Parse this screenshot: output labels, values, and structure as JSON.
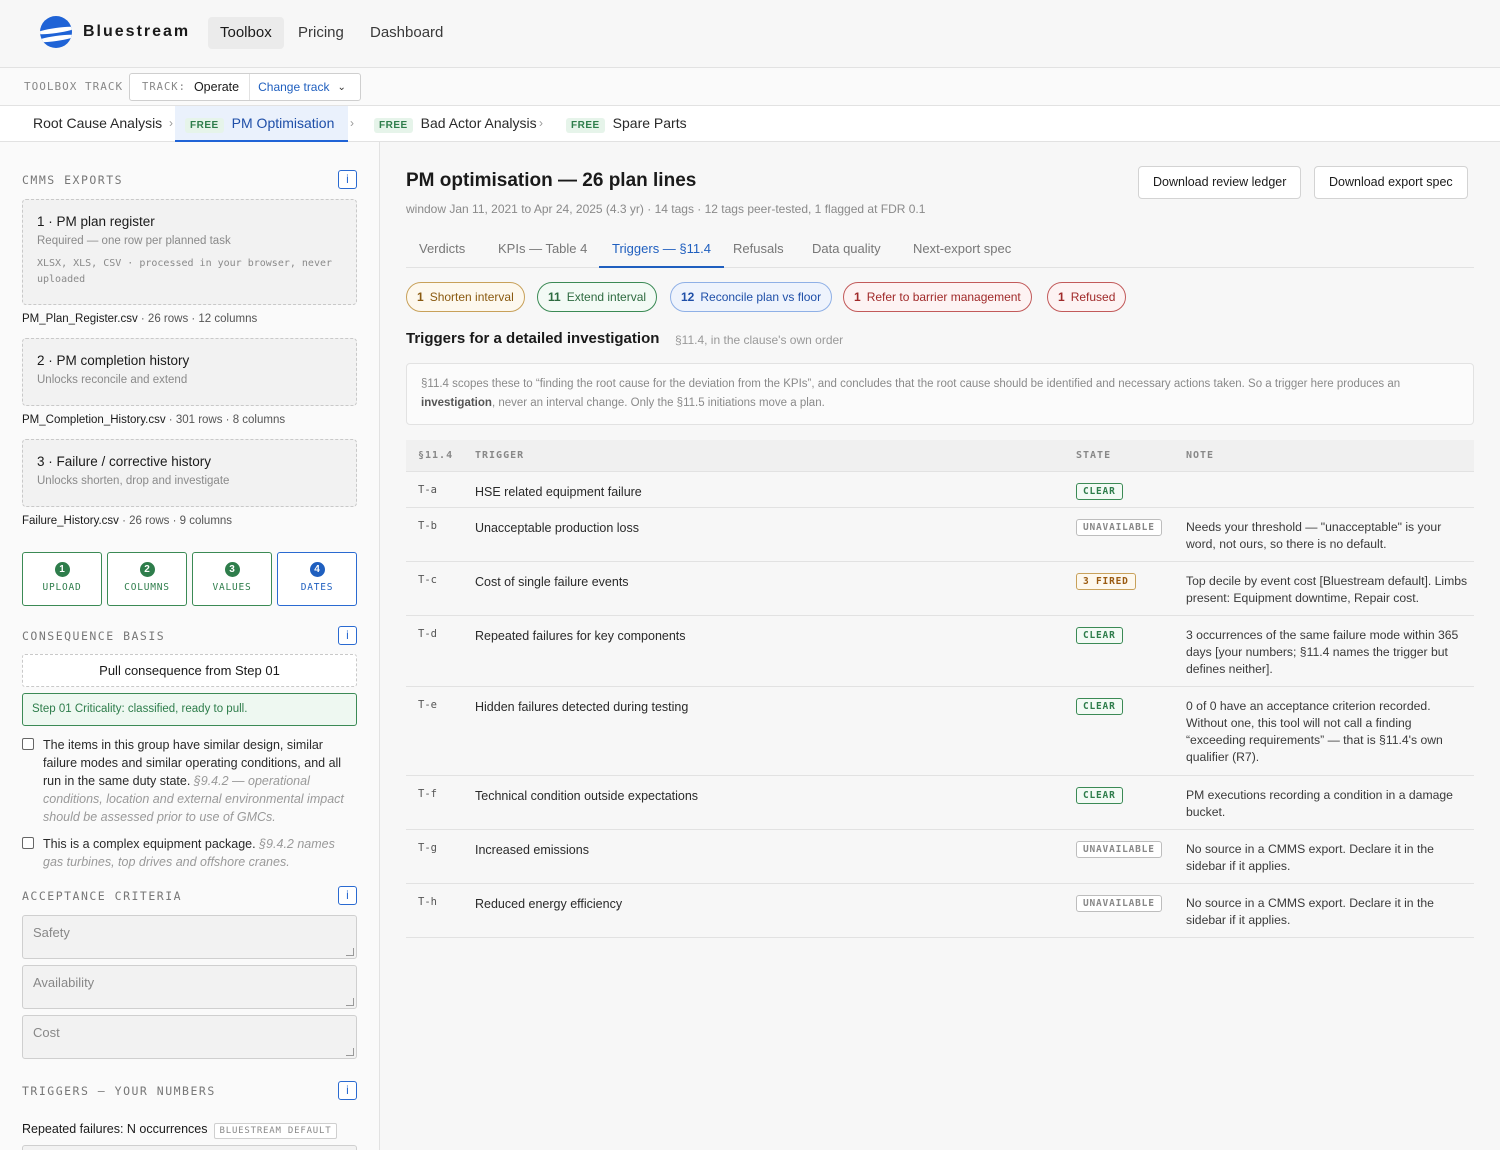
{
  "brand": {
    "name": "Bluestream"
  },
  "nav": {
    "items": [
      "Toolbox",
      "Pricing",
      "Dashboard"
    ],
    "active": "Toolbox"
  },
  "track": {
    "label": "TOOLBOX TRACK",
    "key": "TRACK:",
    "value": "Operate",
    "change": "Change track"
  },
  "tools": [
    {
      "label": "Root Cause Analysis",
      "free": ""
    },
    {
      "label": "PM Optimisation",
      "free": "FREE"
    },
    {
      "label": "Bad Actor Analysis",
      "free": "FREE"
    },
    {
      "label": "Spare Parts",
      "free": "FREE"
    }
  ],
  "sidebar": {
    "cmms_title": "CMMS EXPORTS",
    "info": "i",
    "drop1": {
      "title": "1 · PM plan register",
      "sub": "Required — one row per planned task",
      "mono": "XLSX, XLS, CSV · processed in your browser, never uploaded"
    },
    "file1": {
      "name": "PM_Plan_Register.csv",
      "meta": " · 26 rows · 12 columns"
    },
    "drop2": {
      "title": "2 · PM completion history",
      "sub": "Unlocks reconcile and extend"
    },
    "file2": {
      "name": "PM_Completion_History.csv",
      "meta": " · 301 rows · 8 columns"
    },
    "drop3": {
      "title": "3 · Failure / corrective history",
      "sub": "Unlocks shorten, drop and investigate"
    },
    "file3": {
      "name": "Failure_History.csv",
      "meta": " · 26 rows · 9 columns"
    },
    "steps": [
      {
        "n": "1",
        "label": "UPLOAD"
      },
      {
        "n": "2",
        "label": "COLUMNS"
      },
      {
        "n": "3",
        "label": "VALUES"
      },
      {
        "n": "4",
        "label": "DATES"
      }
    ],
    "consequence_title": "CONSEQUENCE BASIS",
    "pull_button": "Pull consequence from Step 01",
    "ok_status": "Step 01 Criticality: classified, ready to pull.",
    "check1": {
      "text": "The items in this group have similar design, similar failure modes and similar operating conditions, and all run in the same duty state.",
      "hint": "§9.4.2 — operational conditions, location and external environmental impact should be assessed prior to use of GMCs."
    },
    "check2": {
      "text": "This is a complex equipment package.",
      "hint": "§9.4.2 names gas turbines, top drives and offshore cranes."
    },
    "acceptance_title": "ACCEPTANCE CRITERIA",
    "acceptance_placeholders": [
      "Safety",
      "Availability",
      "Cost"
    ],
    "triggers_title": "TRIGGERS — YOUR NUMBERS",
    "repeated_label": "Repeated failures: N occurrences",
    "repeated_badge": "BLUESTREAM DEFAULT"
  },
  "main": {
    "title": "PM optimisation — 26 plan lines",
    "subtitle": "window Jan 11, 2021 to Apr 24, 2025 (4.3 yr) · 14 tags · 12 tags peer-tested, 1 flagged at FDR 0.1",
    "buttons": {
      "ledger": "Download review ledger",
      "spec": "Download export spec"
    },
    "tabs": [
      "Verdicts",
      "KPIs — Table 4",
      "Triggers — §11.4",
      "Refusals",
      "Data quality",
      "Next-export spec"
    ],
    "active_tab": "Triggers — §11.4",
    "pills": [
      {
        "count": "1",
        "label": "Shorten interval",
        "kind": "amber"
      },
      {
        "count": "11",
        "label": "Extend interval",
        "kind": "green"
      },
      {
        "count": "12",
        "label": "Reconcile plan vs floor",
        "kind": "blue"
      },
      {
        "count": "1",
        "label": "Refer to barrier management",
        "kind": "red"
      },
      {
        "count": "1",
        "label": "Refused",
        "kind": "red"
      }
    ],
    "section_title": "Triggers for a detailed investigation",
    "section_sub": "§11.4, in the clause's own order",
    "note": {
      "pre": "§11.4 scopes these to “finding the root cause for the deviation from the KPIs”, and concludes that the root cause should be identified and necessary actions taken. So a trigger here produces an ",
      "bold": "investigation",
      "post": ", never an interval change. Only the §11.5 initiations move a plan."
    },
    "table": {
      "headers": [
        "§11.4",
        "TRIGGER",
        "STATE",
        "NOTE"
      ],
      "rows": [
        {
          "code": "T-a",
          "trigger": "HSE related equipment failure",
          "state": "CLEAR",
          "kind": "clear",
          "note": ""
        },
        {
          "code": "T-b",
          "trigger": "Unacceptable production loss",
          "state": "UNAVAILABLE",
          "kind": "unav",
          "note": "Needs your threshold — \"unacceptable\" is your word, not ours, so there is no default."
        },
        {
          "code": "T-c",
          "trigger": "Cost of single failure events",
          "state": "3 FIRED",
          "kind": "fired",
          "note": "Top decile by event cost [Bluestream default]. Limbs present: Equipment downtime, Repair cost."
        },
        {
          "code": "T-d",
          "trigger": "Repeated failures for key components",
          "state": "CLEAR",
          "kind": "clear",
          "note": "3 occurrences of the same failure mode within 365 days [your numbers; §11.4 names the trigger but defines neither]."
        },
        {
          "code": "T-e",
          "trigger": "Hidden failures detected during testing",
          "state": "CLEAR",
          "kind": "clear",
          "note": "0 of 0 have an acceptance criterion recorded. Without one, this tool will not call a finding “exceeding requirements” — that is §11.4's own qualifier (R7)."
        },
        {
          "code": "T-f",
          "trigger": "Technical condition outside expectations",
          "state": "CLEAR",
          "kind": "clear",
          "note": "PM executions recording a condition in a damage bucket."
        },
        {
          "code": "T-g",
          "trigger": "Increased emissions",
          "state": "UNAVAILABLE",
          "kind": "unav",
          "note": "No source in a CMMS export. Declare it in the sidebar if it applies."
        },
        {
          "code": "T-h",
          "trigger": "Reduced energy efficiency",
          "state": "UNAVAILABLE",
          "kind": "unav",
          "note": "No source in a CMMS export. Declare it in the sidebar if it applies."
        }
      ]
    }
  }
}
